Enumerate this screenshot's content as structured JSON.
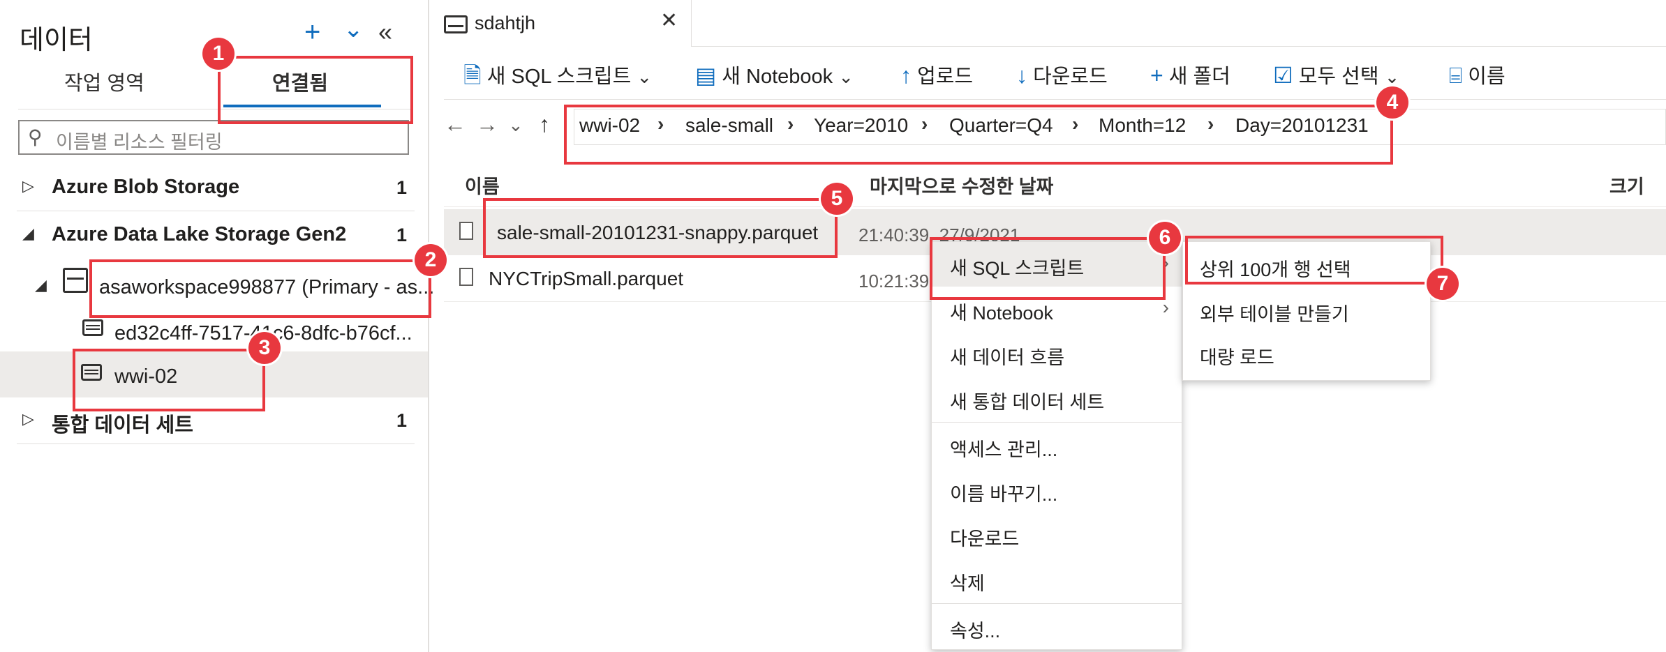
{
  "left_panel": {
    "title": "데이터",
    "header_icons": [
      "add-icon",
      "expand-all-icon",
      "collapse-panel-icon"
    ],
    "add_glyph": "+",
    "expand_glyph": "⌄",
    "collapse_glyph": "«",
    "tabs": [
      {
        "label": "작업 영역",
        "active": false
      },
      {
        "label": "연결됨",
        "active": true
      }
    ],
    "filter_placeholder": "이름별 리소스 필터링",
    "tree": {
      "blob": {
        "label": "Azure Blob Storage",
        "count": "1"
      },
      "adls": {
        "label": "Azure Data Lake Storage Gen2",
        "count": "1"
      },
      "workspace": {
        "label": "asaworkspace998877 (Primary - as..."
      },
      "container1": {
        "label": "ed32c4ff-7517-41c6-8dfc-b76cf..."
      },
      "container2": {
        "label": "wwi-02"
      },
      "integration": {
        "label": "통합 데이터 세트",
        "count": "1"
      }
    }
  },
  "editor": {
    "tab_title": "sdahtjh",
    "close_glyph": "✕",
    "toolbar": {
      "new_sql": "새 SQL 스크립트",
      "new_notebook": "새 Notebook",
      "upload": "업로드",
      "download": "다운로드",
      "new_folder": "새 폴더",
      "select_all": "모두 선택",
      "rename": "이름"
    },
    "breadcrumb": [
      "wwi-02",
      "sale-small",
      "Year=2010",
      "Quarter=Q4",
      "Month=12",
      "Day=20101231"
    ],
    "crumb_sep": "›",
    "columns": {
      "name": "이름",
      "modified": "마지막으로 수정한 날짜",
      "size": "크기"
    },
    "files": [
      {
        "name": "sale-small-20101231-snappy.parquet",
        "modified": "21:40:39, 27/9/2021"
      },
      {
        "name": "NYCTripSmall.parquet",
        "modified": "10:21:39"
      }
    ]
  },
  "context_menu": {
    "items": [
      "새 SQL 스크립트",
      "새 Notebook",
      "새 데이터 흐름",
      "새 통합 데이터 세트",
      "액세스 관리...",
      "이름 바꾸기...",
      "다운로드",
      "삭제",
      "속성..."
    ],
    "chevron": "›"
  },
  "submenu": {
    "items": [
      "상위 100개 행 선택",
      "외부 테이블 만들기",
      "대량 로드"
    ]
  },
  "callouts": [
    "1",
    "2",
    "3",
    "4",
    "5",
    "6",
    "7"
  ],
  "colors": {
    "accent": "#0f6cbd",
    "callout": "#e8383f",
    "selection": "#edebe9"
  }
}
